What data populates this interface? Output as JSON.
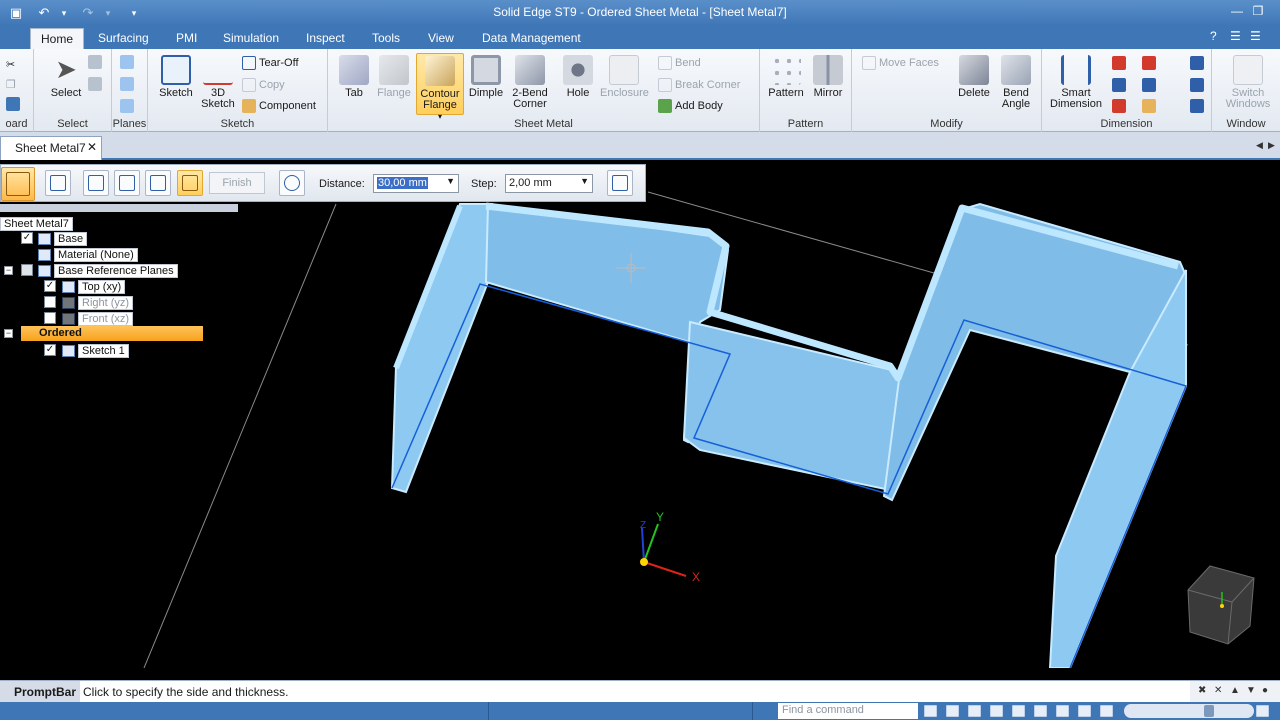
{
  "window": {
    "title": "Solid Edge ST9 - Ordered Sheet Metal - [Sheet Metal7]"
  },
  "ribbon": {
    "tabs": [
      "Home",
      "Surfacing",
      "PMI",
      "Simulation",
      "Inspect",
      "Tools",
      "View",
      "Data Management"
    ],
    "active_tab": "Home",
    "groups": {
      "clipboard": {
        "label": "oard"
      },
      "select": {
        "label": "Select",
        "select_btn": "Select"
      },
      "planes": {
        "label": "Planes"
      },
      "sketch": {
        "label": "Sketch",
        "sketch_btn": "Sketch",
        "sketch3d_btn": "3D Sketch",
        "tear_off": "Tear-Off",
        "copy": "Copy",
        "component": "Component"
      },
      "sheet_metal": {
        "label": "Sheet Metal",
        "tab": "Tab",
        "flange": "Flange",
        "contour_flange": "Contour Flange",
        "dimple": "Dimple",
        "two_bend_corner": "2-Bend Corner",
        "hole": "Hole",
        "enclosure": "Enclosure",
        "bend": "Bend",
        "break_corner": "Break Corner",
        "add_body": "Add Body"
      },
      "pattern": {
        "label": "Pattern",
        "pattern_btn": "Pattern",
        "mirror_btn": "Mirror"
      },
      "modify": {
        "label": "Modify",
        "move_faces": "Move Faces",
        "delete_btn": "Delete",
        "bend_angle": "Bend Angle"
      },
      "dimension": {
        "label": "Dimension",
        "smart_dimension": "Smart Dimension"
      },
      "window": {
        "label": "Window",
        "switch_windows": "Switch Windows"
      }
    }
  },
  "document": {
    "tab_label": "Sheet Metal7"
  },
  "command_bar": {
    "finish_label": "Finish",
    "distance_label": "Distance:",
    "distance_value": "30,00 mm",
    "step_label": "Step:",
    "step_value": "2,00 mm"
  },
  "pathfinder": {
    "root": "Sheet Metal7",
    "base": "Base",
    "material": "Material (None)",
    "ref_planes": "Base Reference Planes",
    "top": "Top (xy)",
    "right": "Right (yz)",
    "front": "Front (xz)",
    "ordered": "Ordered",
    "sketch1": "Sketch 1",
    "checks": {
      "base": true,
      "top": true,
      "right": false,
      "front": false,
      "sketch1": true
    }
  },
  "viewport": {
    "axes": {
      "x": "X",
      "y": "Y",
      "z": "Z"
    },
    "colors": {
      "background": "#000000",
      "part": "#8ec9f2",
      "part_edge": "#c9ebff",
      "sketch_line": "#1560d8"
    }
  },
  "prompt_bar": {
    "title": "PromptBar",
    "message": "Click to specify the side and thickness."
  },
  "status_bar": {
    "find_command_placeholder": "Find a command"
  },
  "colors": {
    "accent": "#3f76b6",
    "highlight": "#ffcf5c",
    "ordered_highlight": "#f7a21b"
  }
}
